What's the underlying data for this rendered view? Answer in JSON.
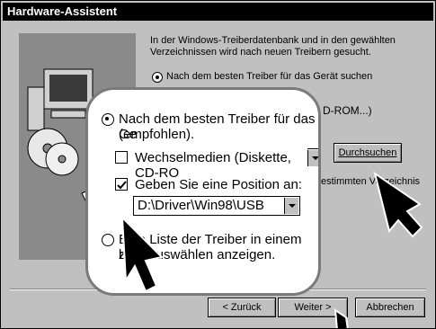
{
  "window": {
    "title": "Hardware-Assistent"
  },
  "intro": "In der Windows-Treiberdatenbank und in den gewählten Verzeichnissen wird nach neuen Treibern gesucht.",
  "background_options": {
    "search_best_driver": "Nach dem besten Treiber für das Gerät suchen",
    "cdrom_partial": "D-ROM...)",
    "location_partial": "estimmten Verzeichnis"
  },
  "zoomed": {
    "radio_search": {
      "line1": "Nach dem besten Treiber für das Ge",
      "line2": "(empfohlen).",
      "checked": true
    },
    "removable_media": {
      "label": "Wechselmedien (Diskette, CD-RO",
      "checked": false
    },
    "specify_location": {
      "label": "Geben Sie eine Position an:",
      "checked": true
    },
    "path_value": "D:\\Driver\\Win98\\USB",
    "radio_list": {
      "line1": "Eine Liste der Treiber in einem bestim",
      "line2": "zum Auswählen anzeigen.",
      "checked": false
    }
  },
  "buttons": {
    "browse": "Durchsuchen",
    "back": "< Zurück",
    "next": "Weiter >",
    "cancel": "Abbrechen"
  }
}
